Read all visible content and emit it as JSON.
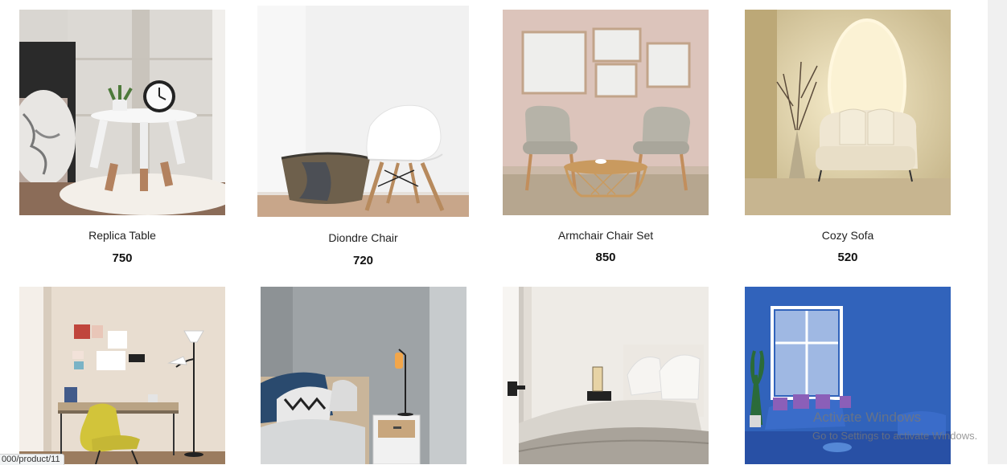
{
  "products": [
    {
      "name": "Replica Table",
      "price": "750"
    },
    {
      "name": "Diondre Chair",
      "price": "720"
    },
    {
      "name": "Armchair Chair Set",
      "price": "850"
    },
    {
      "name": "Cozy Sofa",
      "price": "520"
    },
    {
      "name": "",
      "price": ""
    },
    {
      "name": "",
      "price": ""
    },
    {
      "name": "",
      "price": ""
    },
    {
      "name": "",
      "price": ""
    }
  ],
  "status_bar": {
    "url": "000/product/11"
  },
  "windows_watermark": {
    "title": "Activate Windows",
    "subtitle": "Go to Settings to activate Windows."
  }
}
